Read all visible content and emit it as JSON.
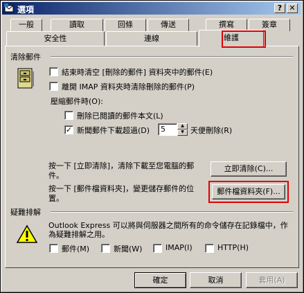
{
  "window": {
    "title": "選項"
  },
  "tabs_top": [
    {
      "label": "一般"
    },
    {
      "label": "讀取"
    },
    {
      "label": "回條"
    },
    {
      "label": "傳送"
    },
    {
      "label": "撰寫"
    },
    {
      "label": "簽章"
    }
  ],
  "tabs_bottom": [
    {
      "label": "安全性"
    },
    {
      "label": "連線"
    },
    {
      "label": "維護"
    }
  ],
  "cleanup": {
    "group_label": "清除郵件",
    "empty_deleted": "結束時清空 [刪除的郵件] 資料夾中的郵件(E)",
    "purge_imap": "離開 IMAP 資料夾時清除刪除的郵件(P)",
    "compact_label": "壓縮郵件時(O):",
    "delete_read_body": "刪除已閱讀的郵件本文(L)",
    "news_prefix": "新聞郵件下載超過(D)",
    "news_days": "5",
    "news_suffix": "天便刪除(R)",
    "clean_now_text": "按一下 [立即清除]，清除下載至您電腦的郵件。",
    "clean_now_button": "立即清除(C)...",
    "store_text": "按一下 [郵件檔資料夾]，變更儲存郵件的位置。",
    "store_button": "郵件檔資料夾(F)..."
  },
  "troubleshoot": {
    "group_label": "疑難排解",
    "text": "Outlook Express 可以將與伺服器之間所有的命令儲存在記錄檔中，作為疑難排解之用。",
    "options": [
      {
        "label": "郵件(M)"
      },
      {
        "label": "新聞(W)"
      },
      {
        "label": "IMAP(I)"
      },
      {
        "label": "HTTP(H)"
      }
    ]
  },
  "footer": {
    "ok": "確定",
    "cancel": "取消",
    "apply": "套用(A)"
  }
}
